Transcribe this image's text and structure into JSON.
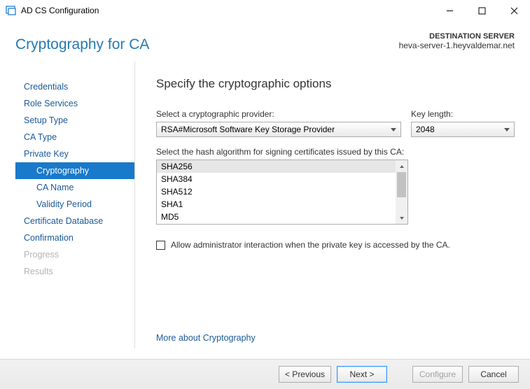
{
  "window": {
    "title": "AD CS Configuration"
  },
  "header": {
    "page_title": "Cryptography for CA",
    "destination_label": "DESTINATION SERVER",
    "destination_value": "heva-server-1.heyvaldemar.net"
  },
  "sidebar": {
    "items": [
      {
        "label": "Credentials",
        "state": "link"
      },
      {
        "label": "Role Services",
        "state": "link"
      },
      {
        "label": "Setup Type",
        "state": "link"
      },
      {
        "label": "CA Type",
        "state": "link"
      },
      {
        "label": "Private Key",
        "state": "link"
      },
      {
        "label": "Cryptography",
        "state": "selected"
      },
      {
        "label": "CA Name",
        "state": "sub"
      },
      {
        "label": "Validity Period",
        "state": "sub"
      },
      {
        "label": "Certificate Database",
        "state": "link"
      },
      {
        "label": "Confirmation",
        "state": "link"
      },
      {
        "label": "Progress",
        "state": "disabled"
      },
      {
        "label": "Results",
        "state": "disabled"
      }
    ]
  },
  "main": {
    "heading": "Specify the cryptographic options",
    "provider_label": "Select a cryptographic provider:",
    "provider_value": "RSA#Microsoft Software Key Storage Provider",
    "keylength_label": "Key length:",
    "keylength_value": "2048",
    "hash_label": "Select the hash algorithm for signing certificates issued by this CA:",
    "hash_options": [
      "SHA256",
      "SHA384",
      "SHA512",
      "SHA1",
      "MD5"
    ],
    "hash_selected_index": 0,
    "allow_admin_label": "Allow administrator interaction when the private key is accessed by the CA.",
    "allow_admin_checked": false,
    "more_link": "More about Cryptography"
  },
  "footer": {
    "previous": "< Previous",
    "next": "Next >",
    "configure": "Configure",
    "cancel": "Cancel"
  }
}
